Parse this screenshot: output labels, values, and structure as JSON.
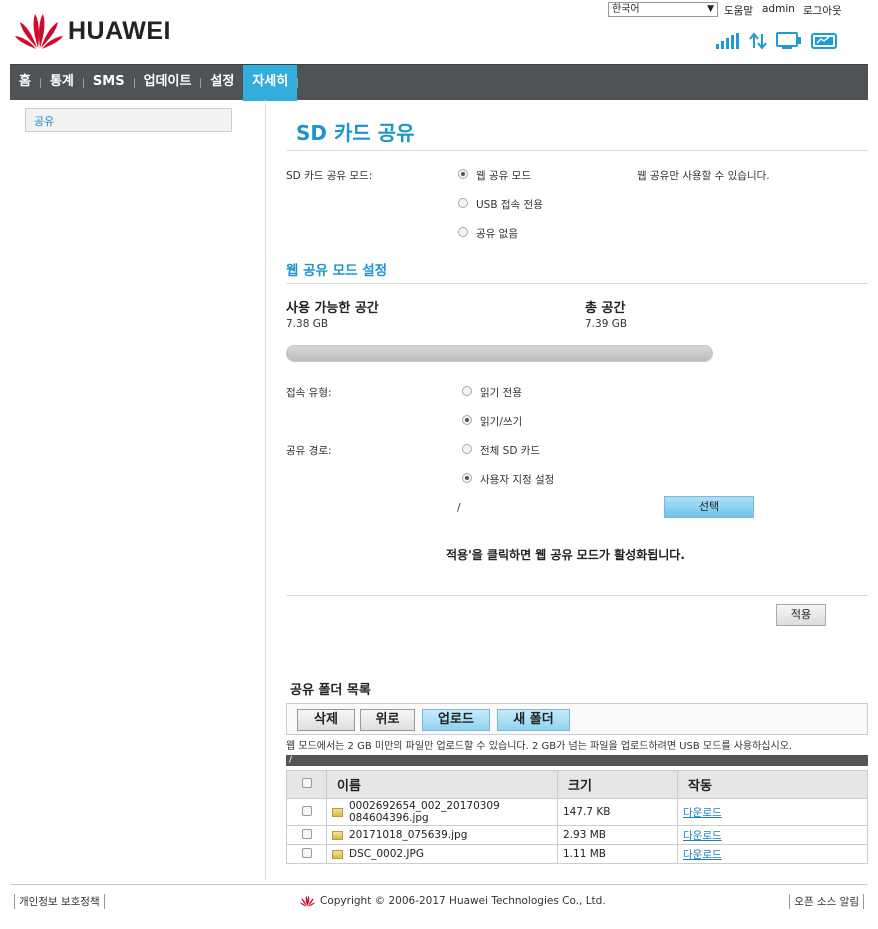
{
  "brand": {
    "name": "HUAWEI",
    "color": "#cf0a2c"
  },
  "header": {
    "language": "한국어",
    "help": "도움말",
    "user": "admin",
    "logout": "로그아웃",
    "status_icons": [
      "signal-icon",
      "data-transfer-icon",
      "device-icon",
      "battery-icon"
    ]
  },
  "nav": {
    "items": [
      "홈",
      "통계",
      "SMS",
      "업데이트",
      "설정",
      "자세히"
    ],
    "active": "자세히"
  },
  "sidebar": {
    "items": [
      "공유"
    ]
  },
  "main": {
    "title": "SD 카드 공유",
    "mode_label": "SD 카드 공유 모드:",
    "mode_options": [
      "웹 공유 모드",
      "USB 접속 전용",
      "공유 없음"
    ],
    "mode_selected": 0,
    "mode_hint": "웹 공유만 사용할 수 있습니다.",
    "web_section_title": "웹 공유 모드 설정",
    "available_label": "사용 가능한 공간",
    "available_value": "7.38 GB",
    "total_label": "총 공간",
    "total_value": "7.39 GB",
    "usage_fraction": 0.0014,
    "access_label": "접속 유형:",
    "access_options": [
      "읽기 전용",
      "읽기/쓰기"
    ],
    "access_selected": 1,
    "path_label": "공유 경로:",
    "path_options": [
      "전체 SD 카드",
      "사용자 지정 설정"
    ],
    "path_selected": 1,
    "path_value": "/",
    "select_button": "선택",
    "notice": "적용'을 클릭하면 웹 공유 모드가 활성화됩니다.",
    "apply_button": "적용"
  },
  "folder": {
    "title": "공유 폴더 목록",
    "buttons": [
      "삭제",
      "위로",
      "업로드",
      "새 폴더"
    ],
    "upload_note": "웹 모드에서는 2 GB 미만의 파일만 업로드할 수 있습니다. 2 GB가 넘는 파일을 업로드하려면 USB 모드를 사용하십시오.",
    "current_path": "/",
    "columns": [
      "이름",
      "크기",
      "작동"
    ],
    "rows": [
      {
        "name": "0002692654_002_20170309 084604396.jpg",
        "size": "147.7 KB",
        "action": "다운로드"
      },
      {
        "name": "20171018_075639.jpg",
        "size": "2.93 MB",
        "action": "다운로드"
      },
      {
        "name": "DSC_0002.JPG",
        "size": "1.11 MB",
        "action": "다운로드"
      }
    ]
  },
  "footer": {
    "privacy": "개인정보 보호정책",
    "copyright": "Copyright © 2006-2017 Huawei Technologies Co., Ltd.",
    "open_source": "오픈 소스 알림"
  },
  "colors": {
    "accent": "#1b94cf",
    "nav_bg": "#4f5355",
    "nav_active": "#33aedc"
  }
}
